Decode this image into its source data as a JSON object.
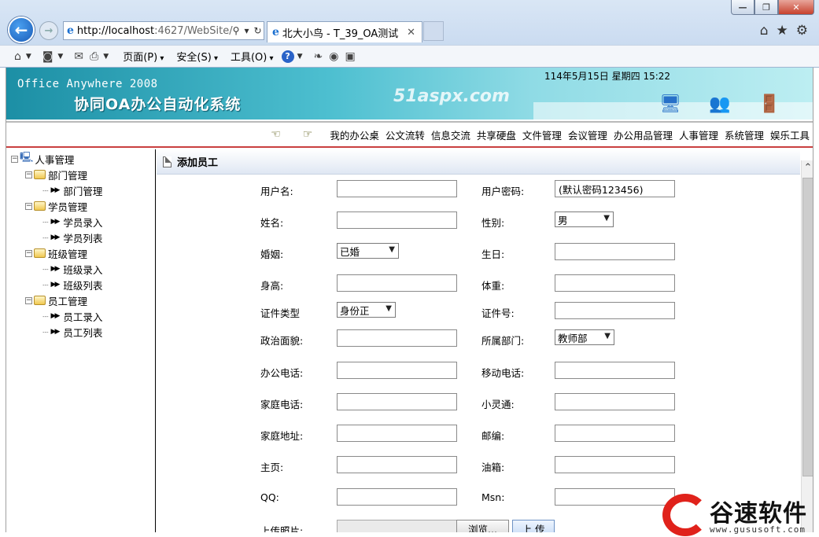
{
  "browser": {
    "url_host": "http://localhost",
    "url_rest": ":4627/WebSite/",
    "tab_title": "北大小鸟 - T_39_OA测试",
    "menus": [
      "页面(P)",
      "安全(S)",
      "工具(O)"
    ]
  },
  "header": {
    "brand_en": "Office Anywhere 2008",
    "brand_cn": "协同OA办公自动化系统",
    "watermark": "51aspx.com",
    "datetime": "114年5月15日 星期四 15:22"
  },
  "topnav": [
    "我的办公桌",
    "公文流转",
    "信息交流",
    "共享硬盘",
    "文件管理",
    "会议管理",
    "办公用品管理",
    "人事管理",
    "系统管理",
    "娱乐工具"
  ],
  "tree": {
    "root": "人事管理",
    "groups": [
      {
        "label": "部门管理",
        "items": [
          "部门管理"
        ]
      },
      {
        "label": "学员管理",
        "items": [
          "学员录入",
          "学员列表"
        ]
      },
      {
        "label": "班级管理",
        "items": [
          "班级录入",
          "班级列表"
        ]
      },
      {
        "label": "员工管理",
        "items": [
          "员工录入",
          "员工列表"
        ]
      }
    ]
  },
  "panel": {
    "title": "添加员工"
  },
  "form": {
    "username": "用户名:",
    "password": "用户密码:",
    "password_value": "(默认密码123456)",
    "name": "姓名:",
    "gender": "性别:",
    "gender_value": "男",
    "marriage": "婚姻:",
    "marriage_value": "已婚",
    "birthday": "生日:",
    "height": "身高:",
    "weight": "体重:",
    "id_type": "证件类型",
    "id_type_value": "身份正",
    "id_number": "证件号:",
    "politics": "政治面貌:",
    "department": "所属部门:",
    "department_value": "教师部",
    "office_phone": "办公电话:",
    "mobile": "移动电话:",
    "home_phone": "家庭电话:",
    "phs": "小灵通:",
    "address": "家庭地址:",
    "zipcode": "邮编:",
    "homepage": "主页:",
    "email": "油箱:",
    "qq": "QQ:",
    "msn": "Msn:",
    "photo": "上传照片:",
    "browse_btn": "浏览...",
    "upload_btn": "上 传"
  },
  "logo": {
    "text": "谷速软件",
    "url": "www.gususoft.com"
  }
}
